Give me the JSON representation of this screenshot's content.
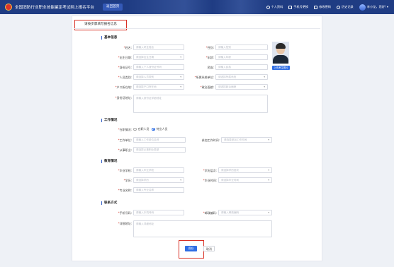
{
  "header": {
    "app_title": "全国消防行业职业技能鉴定考试网上报名平台",
    "home_label": "返回首页",
    "nav": [
      {
        "label": "个人资料",
        "icon": "user-icon"
      },
      {
        "label": "手机号更换",
        "icon": "phone-icon"
      },
      {
        "label": "修改密码",
        "icon": "lock-icon"
      },
      {
        "label": "历史记录",
        "icon": "clock-icon"
      },
      {
        "label": "李小龙，您好! ▾",
        "icon": "avatar"
      }
    ]
  },
  "step_title": "请按步骤填写报名信息",
  "sections": {
    "basic": "基本信息",
    "work": "工作情况",
    "education": "教育情况",
    "contact": "联系方式"
  },
  "basic": {
    "name": {
      "label": "姓名:",
      "placeholder": "请输入考生姓名"
    },
    "gender": {
      "label": "性别:",
      "placeholder": "请输入性别"
    },
    "birth": {
      "label": "出生日期:",
      "placeholder": "请选择出生日期"
    },
    "age": {
      "label": "年龄:",
      "placeholder": "请输入年龄"
    },
    "idcard": {
      "label": "身份证号:",
      "placeholder": "请输入个人身份证号码"
    },
    "nation": {
      "label": "民族:",
      "placeholder": "请输入民族"
    },
    "category": {
      "label": "人员类别:",
      "placeholder": "请选择人员类别"
    },
    "sector": {
      "label": "所属系统单位:",
      "placeholder": "请选择所属系统"
    },
    "hukou": {
      "label": "户口所在地:",
      "placeholder": "请选择户口所在地"
    },
    "politics": {
      "label": "政治面貌:",
      "placeholder": "请选择政治面貌"
    },
    "address": {
      "label": "身份证地址:",
      "placeholder": "请输入身份证详细地址"
    },
    "upload": "上传考生照片"
  },
  "work": {
    "status_label": "在职情况:",
    "status_opts": [
      "在职人员",
      "待业人员"
    ],
    "unit": {
      "label": "工作单位:",
      "placeholder": "请输入工作单位名称"
    },
    "years": {
      "label": "参加工作时间:",
      "placeholder": "请选择参加工作时间"
    },
    "job": {
      "label": "从事职业:",
      "placeholder": "请选择从事职业类型"
    }
  },
  "education": {
    "school": {
      "label": "毕业学校:",
      "placeholder": "请输入毕业学校"
    },
    "degree": {
      "label": "学历层次:",
      "placeholder": "请选择学历层次"
    },
    "edu": {
      "label": "学历:",
      "placeholder": "请选择学历"
    },
    "grad_time": {
      "label": "毕业时间:",
      "placeholder": "请选择毕业时间"
    },
    "major": {
      "label": "专业名称:",
      "placeholder": "请输入专业名称"
    }
  },
  "contact": {
    "mobile": {
      "label": "手机号码:",
      "placeholder": "请输入手机号码"
    },
    "postal": {
      "label": "邮政编码:",
      "placeholder": "请输入邮政编码"
    },
    "address": {
      "label": "详细地址:",
      "placeholder": "请输入详细地址"
    }
  },
  "actions": {
    "save": "保存",
    "cancel": "取消"
  },
  "colors": {
    "topbar": "#1f3c83",
    "primary": "#2f6ee4",
    "highlight": "#d93025"
  }
}
